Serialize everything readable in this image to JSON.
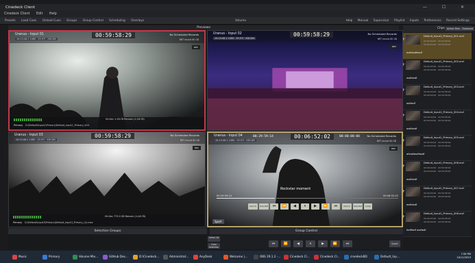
{
  "window": {
    "title": "Cinedeck Client",
    "controls": "— ☐ ✕"
  },
  "menu": [
    "Cinedeck Client",
    "Edit",
    "Help"
  ],
  "toolbar": {
    "left": [
      "Presets",
      "Load Cues",
      "Unload Cues",
      "Groups",
      "Group Control",
      "Scheduling",
      "Overlays"
    ],
    "center": "Volume",
    "right": [
      "Help",
      "Manual",
      "Supervisor",
      "Playlist",
      "Inputs",
      "Preferences",
      "Record Settings"
    ]
  },
  "previews": {
    "title": "Previews"
  },
  "panes": [
    {
      "name": "Uranus - Input 01",
      "meta": "10:13:46.1  1080  ·  29.97i  ·  XDCAM",
      "timecode": "00:59:58:29",
      "schedule": "No Scheduled Records",
      "resolution": "NRT record 80 GB",
      "chip": "REC",
      "meter_label": "Primary",
      "foot_time": "Hh:Sec  1:18:78 Remain (1:18:78)",
      "path_label": "Primary",
      "path": "D:\\Default\\Input1\\Primary\\Default_Input1_Primary_004"
    },
    {
      "name": "Uranus - Input 02",
      "meta": "10:13:46.1  1080  ·  29.97i  ·  XDCAM",
      "timecode": "00:59:58:29",
      "schedule": "No Scheduled Records",
      "resolution": "NRT record 80 GB",
      "chip": "REC"
    },
    {
      "name": "Uranus - Input 03",
      "meta": "10:13:46.1  1080  ·  29.97i  ·  XDCAM",
      "timecode": "00:59:58:29",
      "schedule": "No Scheduled Records",
      "resolution": "NRT record 80 GB",
      "chip": "REC",
      "meter_label": "Primary",
      "foot_time": "Hh:Sec  779.0 GB Remain (1:46:78)",
      "path_label": "Primary",
      "path": "D:\\Default\\Input3\\Primary\\Default_Input3_Primary_(h).mov"
    },
    {
      "name": "Uranus - Input 04",
      "meta": "10:13:46.1  1080  ·  29.97i  ·  XDCAM",
      "timecode_in": "00:29:59:14",
      "timecode": "00:06:52:02",
      "timecode_out": "00:00:00:00",
      "schedule": "No Scheduled Records",
      "resolution": "NRT record 80 GB",
      "chip": "REC",
      "clip_title": "Rockstar moment",
      "prog_left": "00:29:59:14",
      "prog_right": "00:06:52:02",
      "progress": 0.32,
      "transport": [
        "Cue In",
        "Cue Out",
        "⏮",
        "⏪",
        "◀",
        "⏸",
        "▶",
        "⏩",
        "⏭",
        "Cue In",
        "Cue Out",
        "Loop"
      ],
      "sport": "Sport"
    }
  ],
  "clips": {
    "title": "Clips",
    "tabs": [
      "Active Files",
      "Clipboard"
    ],
    "items": [
      {
        "name": "Default_Input1_Primary_001.mxf",
        "grid": "00:00:00:00   00:59:58:29\n00:00:00:00   00:59:58:29",
        "tag": "asdfasdfasdf",
        "selected": true
      },
      {
        "name": "Default_Input1_Primary_002.mxf",
        "grid": "00:00:00:00   00:59:58:29\n00:00:00:00   00:59:58:29",
        "tag": "asdfasdf",
        "selected": false
      },
      {
        "name": "Default_Input1_Primary_003.mxf",
        "grid": "00:00:00:00   00:59:58:29\n00:00:00:00   00:59:58:29",
        "tag": "asfasdf",
        "selected": false
      },
      {
        "name": "Default_Input1_Primary_004.mxf",
        "grid": "00:00:00:00   00:59:58:29\n00:00:00:00   00:59:58:29",
        "tag": "asdfasdf",
        "selected": false
      },
      {
        "name": "Default_Input1_Primary_005.mxf",
        "grid": "00:00:00:00   00:59:58:29\n00:00:00:00   00:59:58:29",
        "tag": "afsdafasdfasdf",
        "selected": false
      },
      {
        "name": "Default_Input1_Primary_006.mxf",
        "grid": "00:00:00:00   00:59:58:29\n00:00:00:00   00:59:58:29",
        "tag": "asdfasdf",
        "selected": false
      },
      {
        "name": "Default_Input1_Primary_007.mxf",
        "grid": "00:00:00:00   00:59:58:29\n00:00:00:00   00:59:58:29",
        "tag": "asdfasdf",
        "selected": false
      },
      {
        "name": "Default_Input1_Primary_008.mxf",
        "grid": "00:00:00:00   00:59:58:29\n00:00:00:00   00:59:58:29",
        "tag": "fadffadf asdfadf",
        "selected": false
      }
    ]
  },
  "selection_groups": {
    "title": "Selection Groups"
  },
  "group_control": {
    "title": "Group Control",
    "side": [
      "Select All",
      "Clear Selection"
    ],
    "buttons": [
      "⏮",
      "⏪",
      "◀",
      "⏸",
      "▶",
      "⏩",
      "⏭"
    ],
    "sport": "Sport"
  },
  "taskbar": {
    "items": [
      {
        "label": "Music",
        "color": "#d44"
      },
      {
        "label": "Primary",
        "color": "#3a7bd5"
      },
      {
        "label": "Volume Mix...",
        "color": "#2f8f4e"
      },
      {
        "label": "GitHub Des...",
        "color": "#8a5cd0"
      },
      {
        "label": "D:\\Cinedeck...",
        "color": "#e1a12f"
      },
      {
        "label": "Administrat...",
        "color": "#555"
      },
      {
        "label": "AnyDesk",
        "color": "#e0453a"
      },
      {
        "label": "Welcome |...",
        "color": "#e6562c"
      },
      {
        "label": "OBS 29.1.2 -...",
        "color": "#444"
      },
      {
        "label": "Cinedeck Cl...",
        "color": "#c33"
      },
      {
        "label": "Cinedeck Cl...",
        "color": "#c33"
      },
      {
        "label": "cinedeckBD",
        "color": "#2b6cb0"
      },
      {
        "label": "Default_Inp...",
        "color": "#2b6cb0"
      }
    ],
    "time": "7:58 PM",
    "date": "10/11/2023"
  }
}
